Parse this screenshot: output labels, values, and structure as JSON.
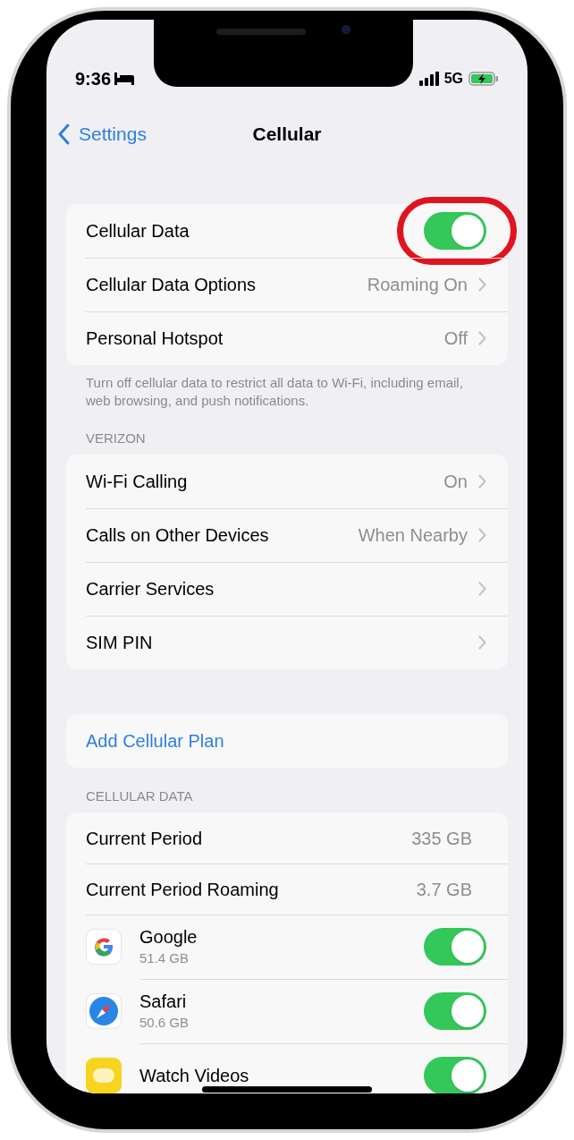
{
  "status_bar": {
    "time": "9:36",
    "network": "5G"
  },
  "nav": {
    "back": "Settings",
    "title": "Cellular"
  },
  "sections": [
    {
      "rows": [
        {
          "kind": "toggle",
          "label": "Cellular Data",
          "on": true,
          "highlighted": true
        },
        {
          "kind": "link",
          "label": "Cellular Data Options",
          "value": "Roaming On"
        },
        {
          "kind": "link",
          "label": "Personal Hotspot",
          "value": "Off"
        }
      ],
      "footer": "Turn off cellular data to restrict all data to Wi-Fi, including email, web browsing, and push notifications."
    },
    {
      "header": "VERIZON",
      "rows": [
        {
          "kind": "link",
          "label": "Wi-Fi Calling",
          "value": "On"
        },
        {
          "kind": "link",
          "label": "Calls on Other Devices",
          "value": "When Nearby"
        },
        {
          "kind": "link",
          "label": "Carrier Services"
        },
        {
          "kind": "link",
          "label": "SIM PIN"
        }
      ]
    },
    {
      "rows": [
        {
          "kind": "action",
          "label": "Add Cellular Plan"
        }
      ]
    },
    {
      "header": "CELLULAR DATA",
      "rows": [
        {
          "kind": "usage",
          "label": "Current Period",
          "value": "335 GB"
        },
        {
          "kind": "usage",
          "label": "Current Period Roaming",
          "value": "3.7 GB"
        },
        {
          "kind": "app",
          "label": "Google",
          "detail": "51.4 GB",
          "on": true
        },
        {
          "kind": "app",
          "label": "Safari",
          "detail": "50.6 GB",
          "on": true
        },
        {
          "kind": "app",
          "label": "Watch Videos",
          "on": true
        }
      ]
    }
  ]
}
